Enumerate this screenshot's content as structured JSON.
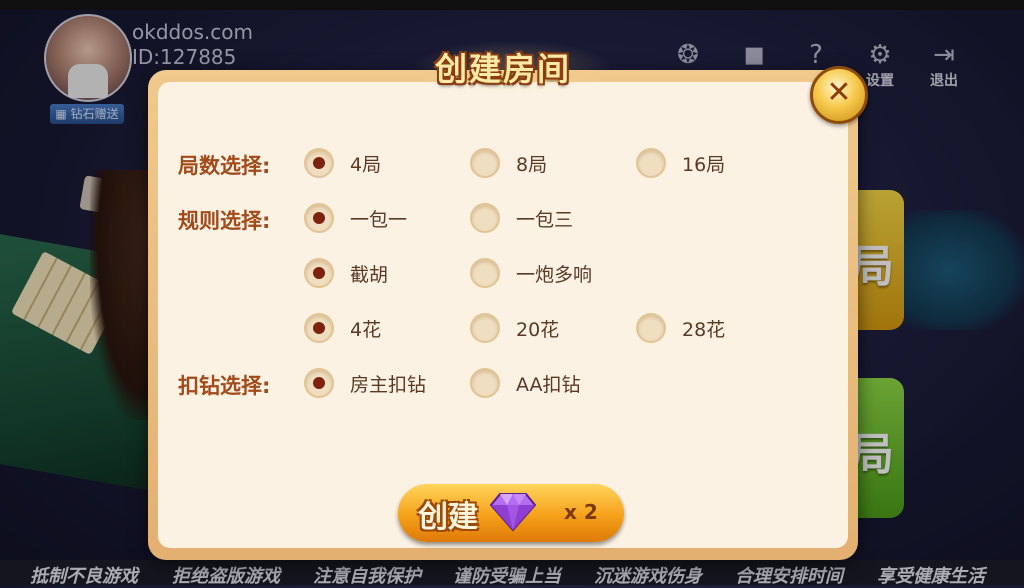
{
  "header": {
    "user_name": "okddos.com",
    "user_id": "ID:127885",
    "gift_label": "钻石赠送",
    "icons": [
      {
        "name": "share",
        "label": "分享"
      },
      {
        "name": "record",
        "label": "战绩"
      },
      {
        "name": "help",
        "label": "帮助"
      },
      {
        "name": "settings",
        "label": "设置"
      },
      {
        "name": "exit",
        "label": "退出"
      }
    ]
  },
  "background": {
    "right_buttons": [
      "局",
      "局"
    ]
  },
  "modal": {
    "title": "创建房间",
    "rows": [
      {
        "label": "局数选择:",
        "options": [
          {
            "text": "4局",
            "checked": true
          },
          {
            "text": "8局",
            "checked": false
          },
          {
            "text": "16局",
            "checked": false
          }
        ]
      },
      {
        "label": "规则选择:",
        "options": [
          {
            "text": "一包一",
            "checked": true
          },
          {
            "text": "一包三",
            "checked": false
          }
        ]
      },
      {
        "label": "",
        "options": [
          {
            "text": "截胡",
            "checked": true
          },
          {
            "text": "一炮多响",
            "checked": false
          }
        ]
      },
      {
        "label": "",
        "options": [
          {
            "text": "4花",
            "checked": true
          },
          {
            "text": "20花",
            "checked": false
          },
          {
            "text": "28花",
            "checked": false
          }
        ]
      },
      {
        "label": "扣钻选择:",
        "options": [
          {
            "text": "房主扣钻",
            "checked": true
          },
          {
            "text": "AA扣钻",
            "checked": false
          }
        ]
      }
    ],
    "create_button": {
      "label": "创建",
      "cost": "x 2"
    }
  },
  "ticker": [
    "抵制不良游戏",
    "拒绝盗版游戏",
    "注意自我保护",
    "谨防受骗上当",
    "沉迷游戏伤身",
    "合理安排时间",
    "享受健康生活"
  ]
}
